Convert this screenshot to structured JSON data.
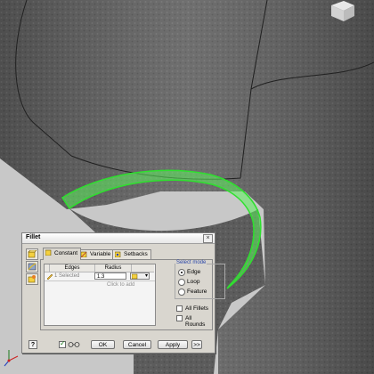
{
  "dialog": {
    "title": "Fillet",
    "close_glyph": "×",
    "side_icons": [
      "edge-fillet-icon",
      "face-fillet-icon",
      "full-round-fillet-icon"
    ],
    "tabs": [
      {
        "label": "Constant",
        "icon": "constant-fillet-icon",
        "active": true
      },
      {
        "label": "Variable",
        "icon": "variable-fillet-icon",
        "active": false
      },
      {
        "label": "Setbacks",
        "icon": "setbacks-icon",
        "active": false
      }
    ],
    "table": {
      "columns": [
        "Edges",
        "Radius"
      ],
      "rows": [
        {
          "edges": "1 Selected",
          "radius": "1.3"
        }
      ],
      "add_row_text": "Click to add"
    },
    "select_mode": {
      "label": "Select mode",
      "options": [
        {
          "label": "Edge",
          "selected": true
        },
        {
          "label": "Loop",
          "selected": false
        },
        {
          "label": "Feature",
          "selected": false
        }
      ]
    },
    "all_fillets_label": "All Fillets",
    "all_rounds_label": "All Rounds",
    "buttons": {
      "help": "?",
      "ok": "OK",
      "cancel": "Cancel",
      "apply": "Apply",
      "more": ">>"
    }
  },
  "colors": {
    "highlight": "#3cf23c",
    "model": "#5a5a5a",
    "background": "#c8c8c8"
  }
}
